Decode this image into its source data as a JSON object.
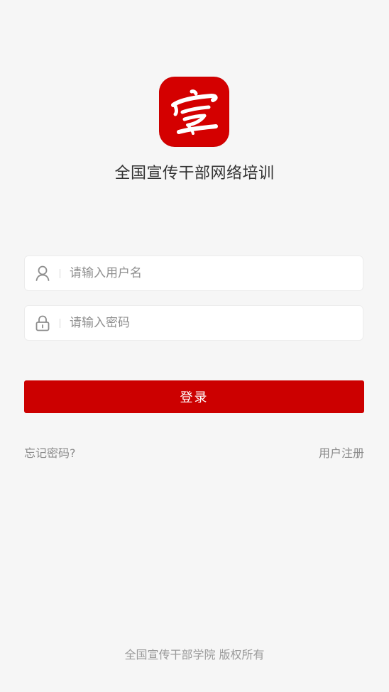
{
  "app": {
    "title": "全国宣传干部网络培训",
    "logo_icon": "xuan-calligraphy-logo-icon",
    "brand_color": "#d40000"
  },
  "form": {
    "username": {
      "placeholder": "请输入用户名",
      "value": "",
      "icon": "user-icon"
    },
    "password": {
      "placeholder": "请输入密码",
      "value": "",
      "icon": "lock-icon"
    },
    "login_label": "登录",
    "login_color": "#cc0000"
  },
  "links": {
    "forgot_password": "忘记密码?",
    "register": "用户注册"
  },
  "footer": {
    "copyright": "全国宣传干部学院  版权所有"
  }
}
